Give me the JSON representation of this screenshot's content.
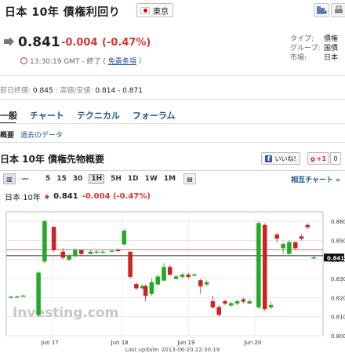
{
  "header": {
    "title": "日本 10年 債権利回り",
    "location": "東京"
  },
  "quote": {
    "price": "0.841",
    "change": "-0.004",
    "change_pct": "(-0.47%)",
    "time": "13:30:19 GMT - 終了 (",
    "disclaimer": "免責条項",
    "time_end": ")"
  },
  "meta": {
    "rows": [
      {
        "k": "タイプ:",
        "v": "債権"
      },
      {
        "k": "グループ:",
        "v": "国債"
      },
      {
        "k": "市場:",
        "v": "日本"
      }
    ]
  },
  "stats": {
    "prev_label": "前日終値:",
    "prev_value": "0.845",
    "range_label": "高値/安値:",
    "range_value": "0.814 - 0.871"
  },
  "tabs": [
    "一般",
    "チャート",
    "テクニカル",
    "フォーラム"
  ],
  "subtabs": [
    "概要",
    "過去のデータ"
  ],
  "section_title": "日本 10年 債権先物概要",
  "social": {
    "fb": "いいね!",
    "gplus": "+1",
    "gcount": "0"
  },
  "toolbar": {
    "intervals": [
      "5",
      "15",
      "30",
      "1H",
      "5H",
      "1D",
      "1W",
      "1M"
    ],
    "selected": "1H",
    "compare": "相互チャート »"
  },
  "chart_header": {
    "name": "日本 10年",
    "price": "0.841",
    "change": "-0.004 (-0.47%)"
  },
  "chart_data": {
    "type": "candlestick",
    "ylim": [
      0.8,
      0.865
    ],
    "yticks": [
      "0.860",
      "0.850",
      "0.840",
      "0.830",
      "0.820",
      "0.810",
      "0.800"
    ],
    "xticks": [
      "Jun 17",
      "Jun 18",
      "Jun 19",
      "Jun 20"
    ],
    "last_price": "0.841",
    "ref_lines": [
      0.845,
      0.842
    ],
    "watermark": "Investing.com",
    "footer": "Last update: 2013-06-20 22:30:19",
    "candles": [
      {
        "t": 0.0,
        "o": 0.82,
        "c": 0.8205,
        "h": 0.8205,
        "l": 0.8195
      },
      {
        "t": 0.02,
        "o": 0.8205,
        "c": 0.8205,
        "h": 0.821,
        "l": 0.82
      },
      {
        "t": 0.04,
        "o": 0.821,
        "c": 0.821,
        "h": 0.8215,
        "l": 0.8205
      },
      {
        "t": 0.09,
        "o": 0.811,
        "c": 0.833,
        "h": 0.834,
        "l": 0.81
      },
      {
        "t": 0.11,
        "o": 0.839,
        "c": 0.86,
        "h": 0.861,
        "l": 0.838
      },
      {
        "t": 0.14,
        "o": 0.857,
        "c": 0.845,
        "h": 0.857,
        "l": 0.844
      },
      {
        "t": 0.17,
        "o": 0.844,
        "c": 0.841,
        "h": 0.846,
        "l": 0.84
      },
      {
        "t": 0.19,
        "o": 0.84,
        "c": 0.842,
        "h": 0.843,
        "l": 0.839
      },
      {
        "t": 0.21,
        "o": 0.842,
        "c": 0.845,
        "h": 0.846,
        "l": 0.841
      },
      {
        "t": 0.23,
        "o": 0.845,
        "c": 0.843,
        "h": 0.845,
        "l": 0.842
      },
      {
        "t": 0.26,
        "o": 0.843,
        "c": 0.844,
        "h": 0.845,
        "l": 0.843
      },
      {
        "t": 0.28,
        "o": 0.844,
        "c": 0.844,
        "h": 0.845,
        "l": 0.843
      },
      {
        "t": 0.3,
        "o": 0.844,
        "c": 0.844,
        "h": 0.845,
        "l": 0.843
      },
      {
        "t": 0.33,
        "o": 0.8445,
        "c": 0.8445,
        "h": 0.845,
        "l": 0.844
      },
      {
        "t": 0.35,
        "o": 0.845,
        "c": 0.8445,
        "h": 0.8455,
        "l": 0.844
      },
      {
        "t": 0.37,
        "o": 0.848,
        "c": 0.855,
        "h": 0.856,
        "l": 0.847
      },
      {
        "t": 0.39,
        "o": 0.844,
        "c": 0.831,
        "h": 0.844,
        "l": 0.83
      },
      {
        "t": 0.41,
        "o": 0.827,
        "c": 0.825,
        "h": 0.828,
        "l": 0.824
      },
      {
        "t": 0.43,
        "o": 0.825,
        "c": 0.826,
        "h": 0.827,
        "l": 0.824
      },
      {
        "t": 0.44,
        "o": 0.826,
        "c": 0.821,
        "h": 0.827,
        "l": 0.818
      },
      {
        "t": 0.46,
        "o": 0.822,
        "c": 0.828,
        "h": 0.83,
        "l": 0.821
      },
      {
        "t": 0.48,
        "o": 0.827,
        "c": 0.831,
        "h": 0.832,
        "l": 0.826
      },
      {
        "t": 0.5,
        "o": 0.829,
        "c": 0.836,
        "h": 0.838,
        "l": 0.829
      },
      {
        "t": 0.52,
        "o": 0.836,
        "c": 0.832,
        "h": 0.837,
        "l": 0.832
      },
      {
        "t": 0.54,
        "o": 0.83,
        "c": 0.831,
        "h": 0.832,
        "l": 0.829
      },
      {
        "t": 0.56,
        "o": 0.831,
        "c": 0.832,
        "h": 0.833,
        "l": 0.83
      },
      {
        "t": 0.58,
        "o": 0.832,
        "c": 0.831,
        "h": 0.833,
        "l": 0.83
      },
      {
        "t": 0.6,
        "o": 0.832,
        "c": 0.832,
        "h": 0.833,
        "l": 0.831
      },
      {
        "t": 0.62,
        "o": 0.829,
        "c": 0.826,
        "h": 0.83,
        "l": 0.822
      },
      {
        "t": 0.64,
        "o": 0.827,
        "c": 0.828,
        "h": 0.829,
        "l": 0.826
      },
      {
        "t": 0.66,
        "o": 0.818,
        "c": 0.815,
        "h": 0.821,
        "l": 0.814
      },
      {
        "t": 0.68,
        "o": 0.815,
        "c": 0.811,
        "h": 0.816,
        "l": 0.81
      },
      {
        "t": 0.7,
        "o": 0.818,
        "c": 0.817,
        "h": 0.819,
        "l": 0.816
      },
      {
        "t": 0.72,
        "o": 0.816,
        "c": 0.817,
        "h": 0.818,
        "l": 0.815
      },
      {
        "t": 0.74,
        "o": 0.817,
        "c": 0.818,
        "h": 0.819,
        "l": 0.816
      },
      {
        "t": 0.76,
        "o": 0.819,
        "c": 0.818,
        "h": 0.82,
        "l": 0.817
      },
      {
        "t": 0.78,
        "o": 0.817,
        "c": 0.818,
        "h": 0.819,
        "l": 0.817
      },
      {
        "t": 0.81,
        "o": 0.815,
        "c": 0.859,
        "h": 0.86,
        "l": 0.814
      },
      {
        "t": 0.83,
        "o": 0.858,
        "c": 0.814,
        "h": 0.859,
        "l": 0.813
      },
      {
        "t": 0.85,
        "o": 0.815,
        "c": 0.816,
        "h": 0.818,
        "l": 0.814
      },
      {
        "t": 0.87,
        "o": 0.853,
        "c": 0.851,
        "h": 0.854,
        "l": 0.849
      },
      {
        "t": 0.89,
        "o": 0.846,
        "c": 0.848,
        "h": 0.849,
        "l": 0.843
      },
      {
        "t": 0.91,
        "o": 0.843,
        "c": 0.849,
        "h": 0.85,
        "l": 0.842
      },
      {
        "t": 0.93,
        "o": 0.849,
        "c": 0.846,
        "h": 0.849,
        "l": 0.845
      },
      {
        "t": 0.95,
        "o": 0.852,
        "c": 0.851,
        "h": 0.853,
        "l": 0.85
      },
      {
        "t": 0.97,
        "o": 0.858,
        "c": 0.857,
        "h": 0.859,
        "l": 0.856
      },
      {
        "t": 0.99,
        "o": 0.841,
        "c": 0.841,
        "h": 0.842,
        "l": 0.841
      }
    ]
  }
}
